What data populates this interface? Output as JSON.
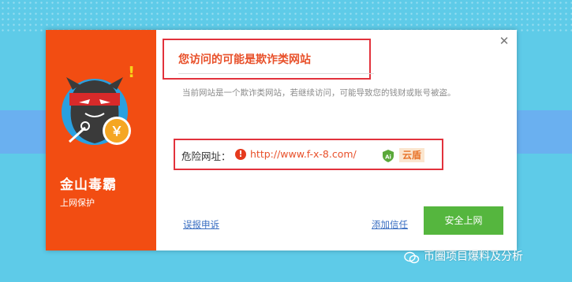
{
  "sidebar": {
    "brand": "金山毒霸",
    "subtitle": "上网保护",
    "mascot_coin_symbol": "￥",
    "mascot_exclaim": "!"
  },
  "dialog": {
    "title": "您访问的可能是欺诈类网站",
    "description": "当前网站是一个欺诈类网站，若继续访问，可能导致您的钱财或账号被盗。",
    "close_glyph": "✕",
    "url_label": "危险网址：",
    "warning_glyph": "!",
    "url": "http://www.f-x-8.com/",
    "ai_badge": "Ai",
    "cloud_shield_label": "云盾",
    "report_link": "误报申诉",
    "trust_link": "添加信任",
    "safe_button": "安全上网"
  },
  "watermark": {
    "text": "币圈项目爆料及分析",
    "icon": "wechat-icon"
  },
  "colors": {
    "sidebar_bg": "#f24d12",
    "title": "#e8502a",
    "highlight_border": "#e2323c",
    "safe_button": "#55b63e",
    "link": "#3b6fc2",
    "page_bg": "#5ecbe8"
  }
}
